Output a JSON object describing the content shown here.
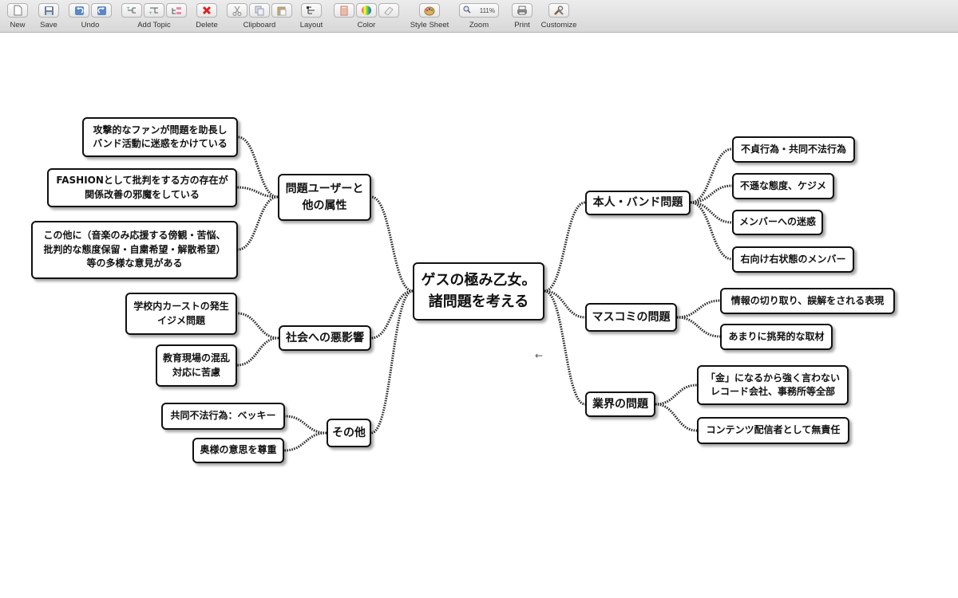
{
  "toolbar": [
    {
      "label": "New",
      "icons": [
        "new-icon"
      ]
    },
    {
      "label": "Save",
      "icons": [
        "save-icon"
      ]
    },
    {
      "label": "Undo",
      "icons": [
        "undo-icon",
        "redo-icon"
      ]
    },
    {
      "label": "Add Topic",
      "icons": [
        "add-topic-icon",
        "add-subtopic-icon",
        "add-sibling-icon"
      ]
    },
    {
      "label": "Delete",
      "icons": [
        "delete-icon"
      ]
    },
    {
      "label": "Clipboard",
      "icons": [
        "cut-icon",
        "copy-icon",
        "paste-icon"
      ]
    },
    {
      "label": "Layout",
      "icons": [
        "layout-icon"
      ]
    },
    {
      "label": "Color",
      "icons": [
        "text-color-icon",
        "color-wheel-icon",
        "eraser-icon"
      ]
    },
    {
      "label": "Style Sheet",
      "icons": [
        "style-sheet-icon"
      ]
    },
    {
      "label": "Zoom",
      "icons": [
        "zoom-icon"
      ],
      "value": "111%"
    },
    {
      "label": "Print",
      "icons": [
        "print-icon"
      ]
    },
    {
      "label": "Customize",
      "icons": [
        "customize-icon"
      ]
    }
  ],
  "mindmap": {
    "central": "ゲスの極み乙女。\n諸問題を考える",
    "left": [
      {
        "label": "問題ユーザーと\n他の属性",
        "children": [
          "攻撃的なファンが問題を助長し\nバンド活動に迷惑をかけている",
          "FASHIONとして批判をする方の存在が\n関係改善の邪魔をしている",
          "この他に（音楽のみ応援する傍観・苦悩、\n批判的な態度保留・自粛希望・解散希望）\n等の多様な意見がある"
        ]
      },
      {
        "label": "社会への悪影響",
        "children": [
          "学校内カーストの発生\nイジメ問題",
          "教育現場の混乱\n対応に苦慮"
        ]
      },
      {
        "label": "その他",
        "children": [
          "共同不法行為：ベッキー",
          "奥様の意思を尊重"
        ]
      }
    ],
    "right": [
      {
        "label": "本人・バンド問題",
        "children": [
          "不貞行為・共同不法行為",
          "不遜な態度、ケジメ",
          "メンバーへの迷惑",
          "右向け右状態のメンバー"
        ]
      },
      {
        "label": "マスコミの問題",
        "children": [
          "情報の切り取り、誤解をされる表現",
          "あまりに挑発的な取材"
        ]
      },
      {
        "label": "業界の問題",
        "children": [
          "「金」になるから強く言わない\nレコード会社、事務所等全部",
          "コンテンツ配信者として無責任"
        ]
      }
    ]
  },
  "colors": {
    "line": "#222222",
    "border": "#111111",
    "toolbar": "#e2e2e2"
  }
}
